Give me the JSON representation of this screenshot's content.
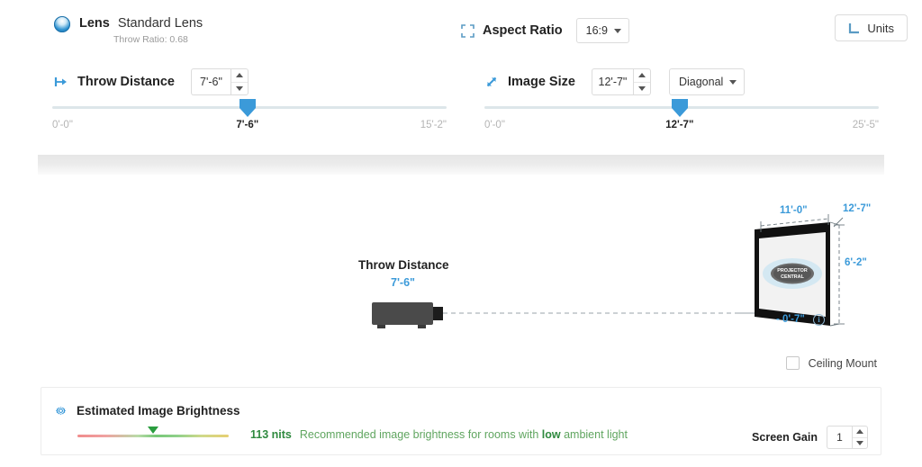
{
  "lens": {
    "icon": "lens-icon",
    "label": "Lens",
    "value": "Standard Lens",
    "throw_ratio": "Throw Ratio: 0.68"
  },
  "aspect_ratio": {
    "icon": "crop-frame-icon",
    "label": "Aspect Ratio",
    "selected": "16:9"
  },
  "units": {
    "icon": "ruler-icon",
    "label": "Units"
  },
  "throw_distance": {
    "icon": "horizontal-measure-icon",
    "label": "Throw Distance",
    "value": "7'-6\"",
    "slider": {
      "min_label": "0'-0\"",
      "max_label": "15'-2\"",
      "current_label": "7'-6\"",
      "percent": 49.5
    }
  },
  "image_size": {
    "icon": "diagonal-arrow-icon",
    "label": "Image Size",
    "value": "12'-7\"",
    "mode": "Diagonal",
    "slider": {
      "min_label": "0'-0\"",
      "max_label": "25'-5\"",
      "current_label": "12'-7\"",
      "percent": 49.5
    }
  },
  "diagram": {
    "throw_title": "Throw Distance",
    "throw_value": "7'-6\"",
    "screen_width": "11'-0\"",
    "screen_diagonal": "12'-7\"",
    "screen_height": "6'-2\"",
    "vertical_offset": "- 0'-7\"",
    "offset_info_icon": "info-icon",
    "screen_logo_line1": "PROJECTOR",
    "screen_logo_line2": "CENTRAL"
  },
  "ceiling_mount": {
    "label": "Ceiling Mount",
    "checked": false
  },
  "brightness": {
    "icon": "gear-icon",
    "title": "Estimated Image Brightness",
    "nits": "113 nits",
    "recommendation_prefix": "Recommended image brightness for rooms with",
    "recommendation_emphasis": "low",
    "recommendation_suffix": "ambient light",
    "marker_percent": 50
  },
  "screen_gain": {
    "label": "Screen Gain",
    "value": "1"
  },
  "colors": {
    "accent_blue": "#3b9ad9",
    "track_gray": "#dde6ea",
    "green": "#2f8a3f"
  }
}
